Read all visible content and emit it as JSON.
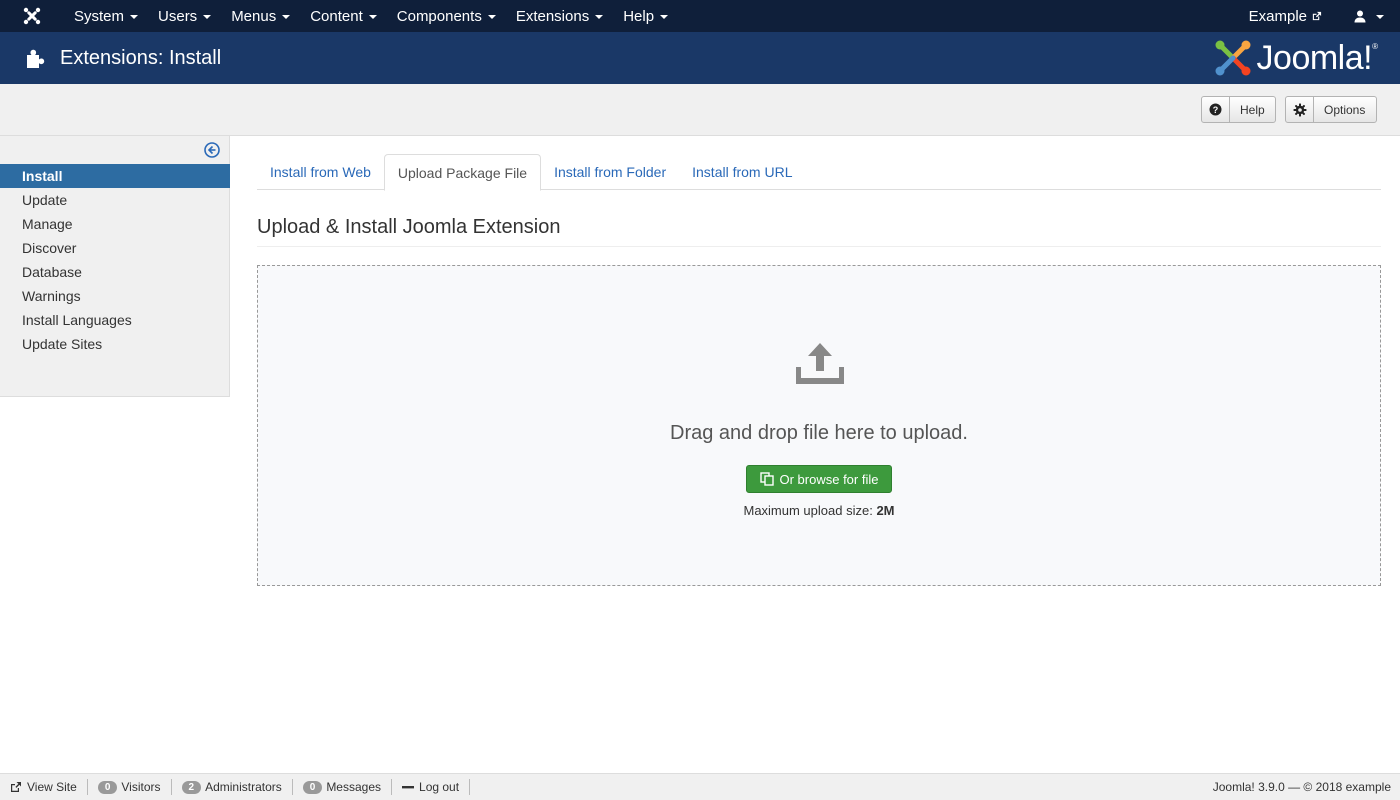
{
  "topnav": {
    "menu": [
      "System",
      "Users",
      "Menus",
      "Content",
      "Components",
      "Extensions",
      "Help"
    ],
    "site_link": "Example"
  },
  "header": {
    "title": "Extensions: Install",
    "brand": "Joomla!"
  },
  "toolbar": {
    "help_label": "Help",
    "options_label": "Options"
  },
  "sidebar": {
    "items": [
      {
        "label": "Install",
        "active": true
      },
      {
        "label": "Update"
      },
      {
        "label": "Manage"
      },
      {
        "label": "Discover"
      },
      {
        "label": "Database"
      },
      {
        "label": "Warnings"
      },
      {
        "label": "Install Languages"
      },
      {
        "label": "Update Sites"
      }
    ]
  },
  "tabs": [
    {
      "label": "Install from Web"
    },
    {
      "label": "Upload Package File",
      "active": true
    },
    {
      "label": "Install from Folder"
    },
    {
      "label": "Install from URL"
    }
  ],
  "main": {
    "section_title": "Upload & Install Joomla Extension",
    "drop_text": "Drag and drop file here to upload.",
    "browse_label": "Or browse for file",
    "max_label": "Maximum upload size: ",
    "max_value": "2M"
  },
  "status": {
    "view_site": "View Site",
    "visitors_count": "0",
    "visitors_label": "Visitors",
    "admins_count": "2",
    "admins_label": "Administrators",
    "messages_count": "0",
    "messages_label": "Messages",
    "logout": "Log out",
    "copyright": "Joomla! 3.9.0  —  © 2018 example"
  },
  "colors": {
    "topnav_bg": "#0f1f3a",
    "header_bg": "#1a3867",
    "active_blue": "#2d6ca2",
    "link_blue": "#2a69b8",
    "success_green": "#3d9a3d"
  }
}
